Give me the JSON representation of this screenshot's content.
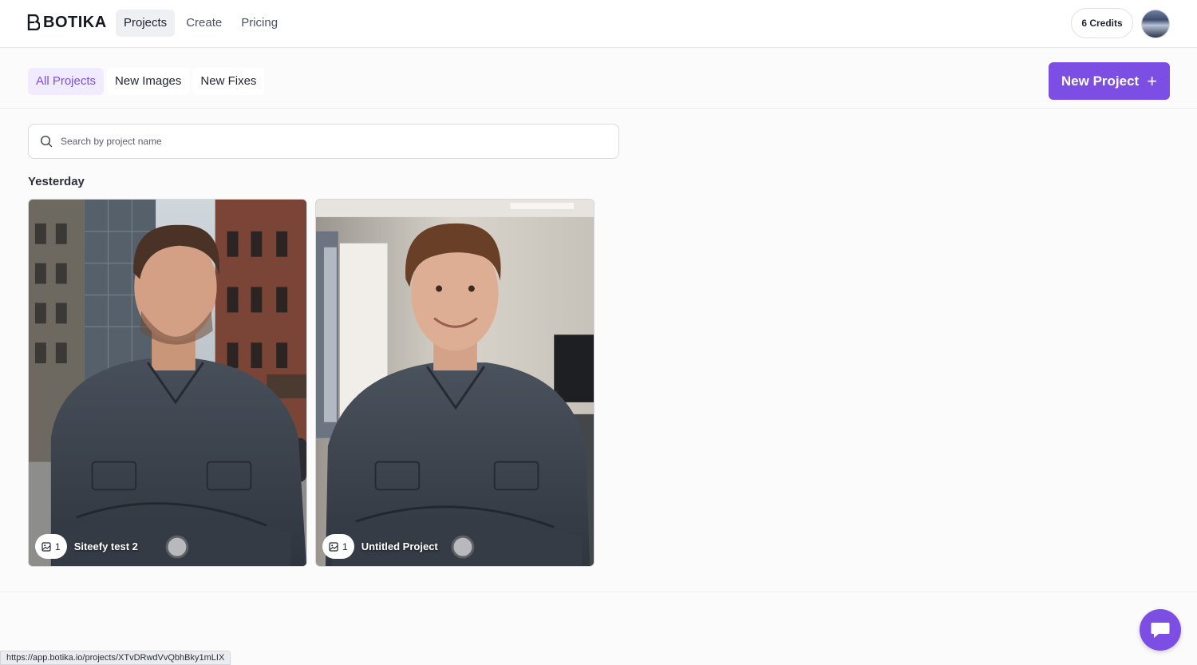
{
  "brand": {
    "name": "BOTIKA"
  },
  "nav": [
    {
      "label": "Projects",
      "active": true
    },
    {
      "label": "Create",
      "active": false
    },
    {
      "label": "Pricing",
      "active": false
    }
  ],
  "account": {
    "credits_label": "6 Credits"
  },
  "filters": [
    {
      "label": "All Projects",
      "active": true
    },
    {
      "label": "New Images",
      "active": false
    },
    {
      "label": "New Fixes",
      "active": false
    }
  ],
  "new_project_label": "New Project",
  "search": {
    "placeholder": "Search by project name",
    "value": ""
  },
  "section_title": "Yesterday",
  "projects": [
    {
      "title": "Siteefy test 2",
      "image_count": "1"
    },
    {
      "title": "Untitled Project",
      "image_count": "1"
    }
  ],
  "status_bar_url": "https://app.botika.io/projects/XTvDRwdVvQbhBky1mLIX",
  "colors": {
    "accent": "#7c4ee4",
    "accent_bg": "#f1ebff"
  }
}
